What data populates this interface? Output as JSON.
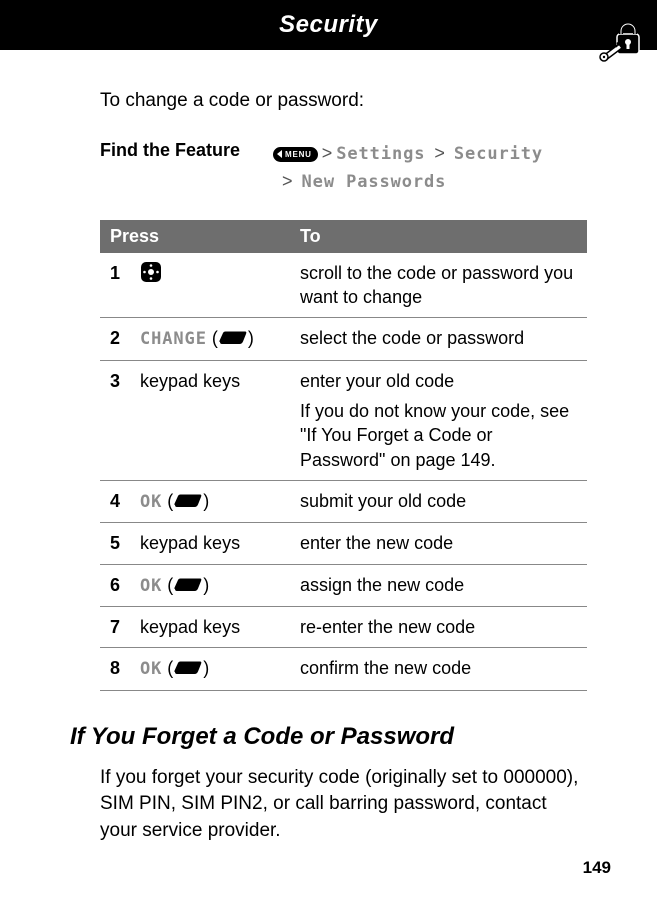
{
  "header": {
    "title": "Security"
  },
  "intro": "To change a code or password:",
  "feature": {
    "label": "Find the Feature",
    "menu_label": "MENU",
    "path1a": "Settings",
    "path1b": "Security",
    "path2": "New Passwords"
  },
  "table": {
    "head_press": "Press",
    "head_to": "To",
    "rows": [
      {
        "n": "1",
        "press_lcd": "",
        "press_text": "",
        "icon": "nav",
        "to": "scroll to the code or password you want to change"
      },
      {
        "n": "2",
        "press_lcd": "CHANGE",
        "press_text": "",
        "icon": "softkey",
        "to": "select the code or password"
      },
      {
        "n": "3",
        "press_lcd": "",
        "press_text": "keypad keys",
        "icon": "",
        "to": "enter your old code",
        "to_extra": "If you do not know your code, see \"If You Forget a Code or Password\" on page 149."
      },
      {
        "n": "4",
        "press_lcd": "OK",
        "press_text": "",
        "icon": "softkey",
        "to": "submit your old code"
      },
      {
        "n": "5",
        "press_lcd": "",
        "press_text": "keypad keys",
        "icon": "",
        "to": "enter the new code"
      },
      {
        "n": "6",
        "press_lcd": "OK",
        "press_text": "",
        "icon": "softkey",
        "to": "assign the new code"
      },
      {
        "n": "7",
        "press_lcd": "",
        "press_text": "keypad keys",
        "icon": "",
        "to": "re-enter the new code"
      },
      {
        "n": "8",
        "press_lcd": "OK",
        "press_text": "",
        "icon": "softkey",
        "to": "confirm the new code"
      }
    ]
  },
  "section": {
    "heading": "If You Forget a Code or Password",
    "body": "If you forget your security code (originally set to 000000), SIM PIN, SIM PIN2, or call barring password, contact your service provider."
  },
  "page_number": "149"
}
